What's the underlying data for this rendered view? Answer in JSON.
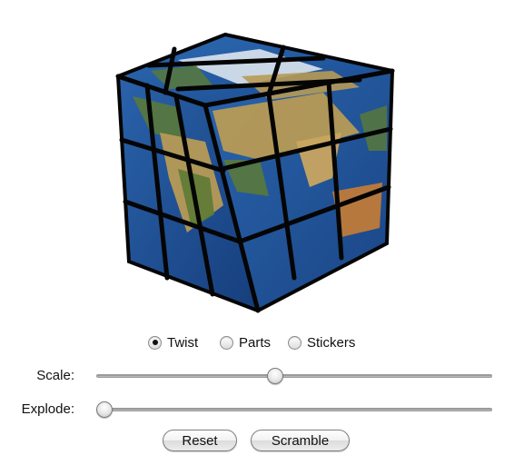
{
  "cube": {
    "icon": "rubiks-cube-earth-map",
    "colors": {
      "ocean": "#1f4f9a",
      "ocean_light": "#3f7fc4",
      "land": "#b79a55",
      "land_green": "#5d7a35",
      "ice": "#e8edf2",
      "grid": "#050505"
    }
  },
  "mode": {
    "options": [
      {
        "label": "Twist",
        "selected": true
      },
      {
        "label": "Parts",
        "selected": false
      },
      {
        "label": "Stickers",
        "selected": false
      }
    ]
  },
  "sliders": {
    "scale": {
      "label": "Scale:",
      "value": 0.45
    },
    "explode": {
      "label": "Explode:",
      "value": 0.0
    }
  },
  "buttons": {
    "reset": "Reset",
    "scramble": "Scramble"
  }
}
